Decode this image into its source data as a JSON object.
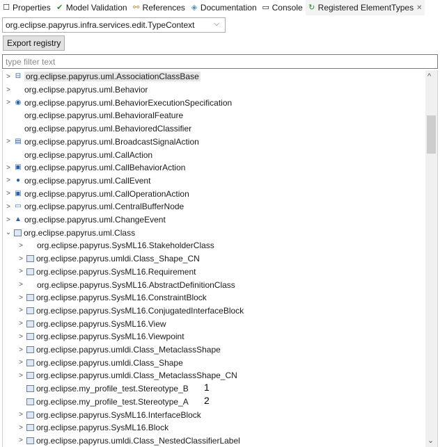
{
  "tabs": [
    {
      "label": "Properties",
      "icon": "properties-icon",
      "glyph": "☐"
    },
    {
      "label": "Model Validation",
      "icon": "checkmark-icon",
      "glyph": "✔"
    },
    {
      "label": "References",
      "icon": "references-icon",
      "glyph": "⚯"
    },
    {
      "label": "Documentation",
      "icon": "documentation-icon",
      "glyph": "◈"
    },
    {
      "label": "Console",
      "icon": "console-icon",
      "glyph": "▭"
    },
    {
      "label": "Registered ElementTypes",
      "icon": "element-types-icon",
      "glyph": "↻",
      "active": true,
      "close": "✕"
    }
  ],
  "context": {
    "selected": "org.eclipse.papyrus.infra.services.edit.TypeContext"
  },
  "export_label": "Export registry",
  "filter": {
    "placeholder": "type filter text"
  },
  "tree_items": [
    {
      "label": "org.eclipse.papyrus.uml.AssociationClassBase",
      "level": 0,
      "twisty": ">",
      "icon": "association-class-icon",
      "glyph": "⊟",
      "selected": true
    },
    {
      "label": "org.eclipse.papyrus.uml.Behavior",
      "level": 0,
      "twisty": ">",
      "icon": ""
    },
    {
      "label": "org.eclipse.papyrus.uml.BehaviorExecutionSpecification",
      "level": 0,
      "twisty": ">",
      "icon": "execution-spec-icon",
      "glyph": "◉"
    },
    {
      "label": "org.eclipse.papyrus.uml.BehavioralFeature",
      "level": 0,
      "twisty": "",
      "icon": ""
    },
    {
      "label": "org.eclipse.papyrus.uml.BehavioredClassifier",
      "level": 0,
      "twisty": "",
      "icon": ""
    },
    {
      "label": "org.eclipse.papyrus.uml.BroadcastSignalAction",
      "level": 0,
      "twisty": ">",
      "icon": "broadcast-signal-icon",
      "glyph": "▤"
    },
    {
      "label": "org.eclipse.papyrus.uml.CallAction",
      "level": 0,
      "twisty": "",
      "icon": ""
    },
    {
      "label": "org.eclipse.papyrus.uml.CallBehaviorAction",
      "level": 0,
      "twisty": ">",
      "icon": "call-behavior-icon",
      "glyph": "▣"
    },
    {
      "label": "org.eclipse.papyrus.uml.CallEvent",
      "level": 0,
      "twisty": ">",
      "icon": "call-event-icon",
      "glyph": "●"
    },
    {
      "label": "org.eclipse.papyrus.uml.CallOperationAction",
      "level": 0,
      "twisty": ">",
      "icon": "call-operation-icon",
      "glyph": "▣"
    },
    {
      "label": "org.eclipse.papyrus.uml.CentralBufferNode",
      "level": 0,
      "twisty": ">",
      "icon": "buffer-node-icon",
      "glyph": "▭"
    },
    {
      "label": "org.eclipse.papyrus.uml.ChangeEvent",
      "level": 0,
      "twisty": ">",
      "icon": "change-event-icon",
      "glyph": "▲"
    },
    {
      "label": "org.eclipse.papyrus.uml.Class",
      "level": 0,
      "twisty": "⌄",
      "icon": "class-icon",
      "box": true
    },
    {
      "label": "org.eclipse.papyrus.SysML16.StakeholderClass",
      "level": 1,
      "twisty": ">",
      "icon": ""
    },
    {
      "label": "org.eclipse.papyrus.umldi.Class_Shape_CN",
      "level": 1,
      "twisty": ">",
      "icon": "class-icon",
      "box": true
    },
    {
      "label": "org.eclipse.papyrus.SysML16.Requirement",
      "level": 1,
      "twisty": ">",
      "icon": "class-icon",
      "box": true
    },
    {
      "label": "org.eclipse.papyrus.SysML16.AbstractDefinitionClass",
      "level": 1,
      "twisty": ">",
      "icon": ""
    },
    {
      "label": "org.eclipse.papyrus.SysML16.ConstraintBlock",
      "level": 1,
      "twisty": ">",
      "icon": "class-icon",
      "box": true
    },
    {
      "label": "org.eclipse.papyrus.SysML16.ConjugatedInterfaceBlock",
      "level": 1,
      "twisty": ">",
      "icon": "class-icon",
      "box": true
    },
    {
      "label": "org.eclipse.papyrus.SysML16.View",
      "level": 1,
      "twisty": ">",
      "icon": "class-icon",
      "box": true
    },
    {
      "label": "org.eclipse.papyrus.SysML16.Viewpoint",
      "level": 1,
      "twisty": ">",
      "icon": "class-icon",
      "box": true
    },
    {
      "label": "org.eclipse.papyrus.umldi.Class_MetaclassShape",
      "level": 1,
      "twisty": ">",
      "icon": "class-icon",
      "box": true
    },
    {
      "label": "org.eclipse.papyrus.umldi.Class_Shape",
      "level": 1,
      "twisty": ">",
      "icon": "class-icon",
      "box": true
    },
    {
      "label": "org.eclipse.papyrus.umldi.Class_MetaclassShape_CN",
      "level": 1,
      "twisty": ">",
      "icon": "class-icon",
      "box": true
    },
    {
      "label": "org.eclipse.my_profile_test.Stereotype_B",
      "level": 1,
      "twisty": "",
      "icon": "class-icon",
      "box": true,
      "note": "1"
    },
    {
      "label": "org.eclipse.my_profile_test.Stereotype_A",
      "level": 1,
      "twisty": "",
      "icon": "class-icon",
      "box": true,
      "note": "2"
    },
    {
      "label": "org.eclipse.papyrus.SysML16.InterfaceBlock",
      "level": 1,
      "twisty": ">",
      "icon": "class-icon",
      "box": true
    },
    {
      "label": "org.eclipse.papyrus.SysML16.Block",
      "level": 1,
      "twisty": ">",
      "icon": "class-icon",
      "box": true
    },
    {
      "label": "org.eclipse.papyrus.umldi.Class_NestedClassifierLabel",
      "level": 1,
      "twisty": ">",
      "icon": "class-icon",
      "box": true
    }
  ],
  "scrollbar": {
    "up": "^",
    "down": "⌄"
  }
}
